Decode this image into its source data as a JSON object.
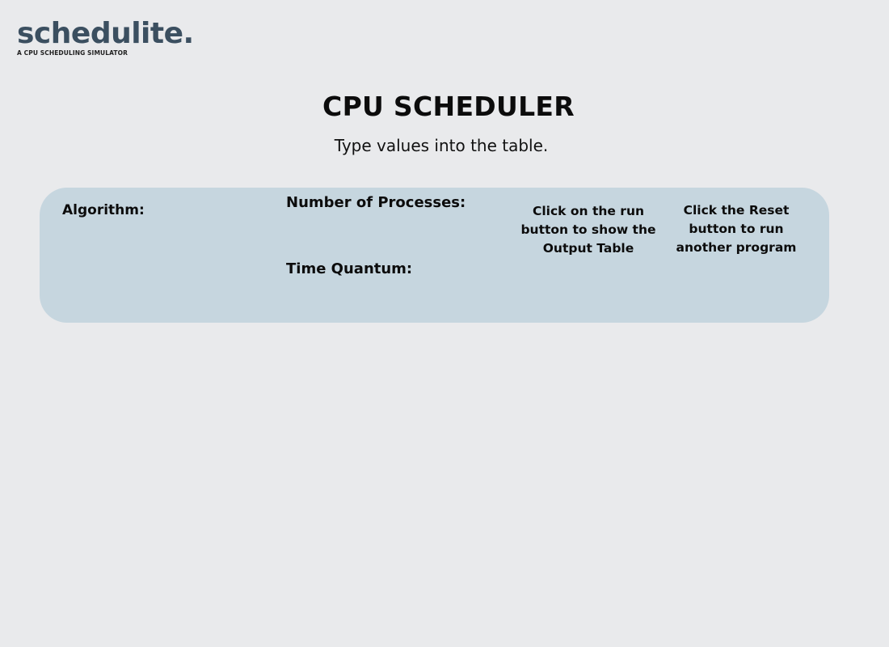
{
  "brand": {
    "name": "schedulite.",
    "tagline": "A CPU SCHEDULING SIMULATOR"
  },
  "header": {
    "title": "CPU SCHEDULER",
    "subtitle": "Type values into the table."
  },
  "controls": {
    "algorithm_label": "Algorithm:",
    "num_processes_label": "Number of Processes:",
    "time_quantum_label": "Time Quantum:",
    "run_hint": "Click on the run button to show the Output Table",
    "reset_hint": "Click the Reset button to run another program"
  },
  "colors": {
    "background": "#e9eaec",
    "panel": "#c6d6df",
    "brand": "#3b4f60"
  }
}
